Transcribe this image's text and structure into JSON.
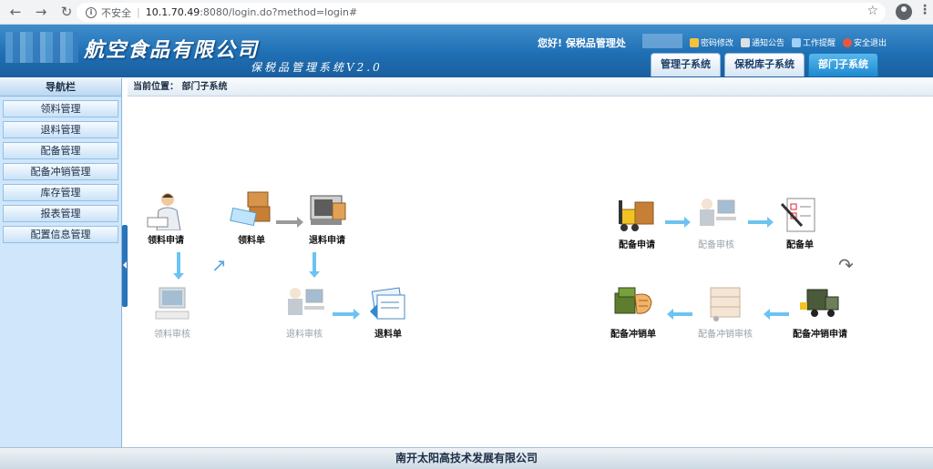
{
  "browser": {
    "security_label": "不安全",
    "url_host": "10.1.70.49",
    "url_path": ":8080/login.do?method=login#"
  },
  "header": {
    "company_name": "航空食品有限公司",
    "system_name": "保税品管理系统V2.0",
    "greeting": "您好!  保税品管理处",
    "links": [
      {
        "label": "密码修改",
        "icon": "key-icon"
      },
      {
        "label": "通知公告",
        "icon": "speaker-icon"
      },
      {
        "label": "工作提醒",
        "icon": "monitor-icon"
      },
      {
        "label": "安全退出",
        "icon": "exit-icon"
      }
    ],
    "tabs": [
      {
        "label": "管理子系统",
        "active": false
      },
      {
        "label": "保税库子系统",
        "active": false
      },
      {
        "label": "部门子系统",
        "active": true
      }
    ]
  },
  "sidebar": {
    "title": "导航栏",
    "items": [
      {
        "label": "领料管理"
      },
      {
        "label": "退料管理"
      },
      {
        "label": "配备管理"
      },
      {
        "label": "配备冲销管理"
      },
      {
        "label": "库存管理"
      },
      {
        "label": "报表管理"
      },
      {
        "label": "配置信息管理"
      }
    ]
  },
  "breadcrumb": {
    "text": "当前位置： 部门子系统"
  },
  "flow_left": {
    "apply": "领料申请",
    "form": "领料单",
    "return_apply": "退料申请",
    "review": "领料审核",
    "return_review": "退料审核",
    "return_form": "退料单"
  },
  "flow_right": {
    "equip_apply": "配备申请",
    "equip_review": "配备审核",
    "equip_form": "配备单",
    "writeoff_apply": "配备冲销申请",
    "writeoff_review": "配备冲销审核",
    "writeoff_form": "配备冲销单"
  },
  "footer": {
    "text": "南开太阳高技术发展有限公司"
  },
  "colors": {
    "header": "#1f6fb4",
    "sidebar": "#cfe6fb",
    "arrow": "#6cc3f2",
    "active_tab": "#1c89cf"
  }
}
